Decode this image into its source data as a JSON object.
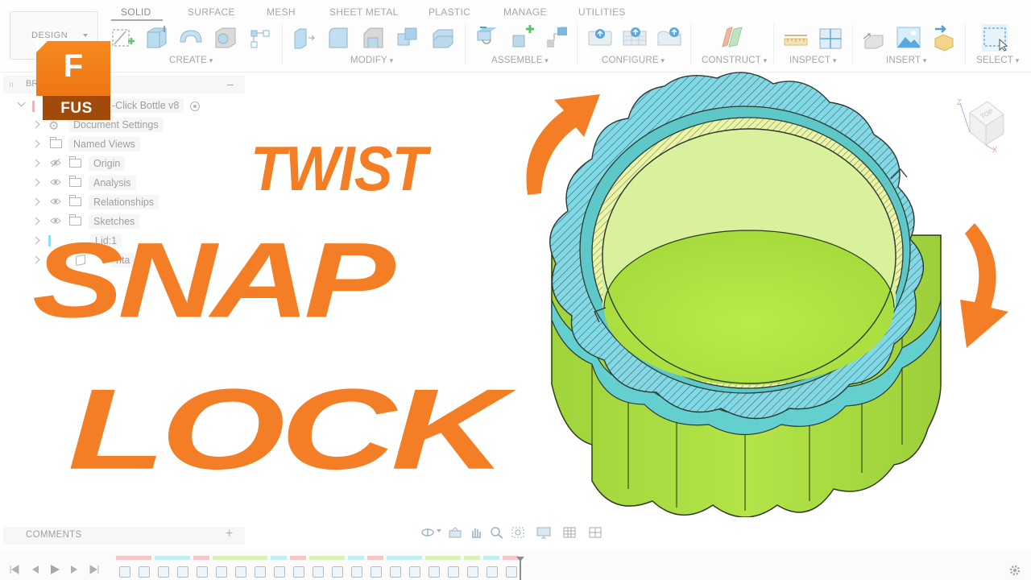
{
  "toolbar": {
    "workspace": "DESIGN",
    "tabs": [
      "SOLID",
      "SURFACE",
      "MESH",
      "SHEET METAL",
      "PLASTIC",
      "MANAGE",
      "UTILITIES"
    ],
    "active_tab": "SOLID",
    "groups": [
      "CREATE",
      "MODIFY",
      "ASSEMBLE",
      "CONFIGURE",
      "CONSTRUCT",
      "INSPECT",
      "INSERT",
      "SELECT"
    ]
  },
  "browser": {
    "title": "BR",
    "root": "-Click Bottle v8",
    "items": [
      "Document Settings",
      "Named Views",
      "Origin",
      "Analysis",
      "Relationships",
      "Sketches",
      "Lid:1",
      "nta"
    ]
  },
  "logo": {
    "letter": "F",
    "text": "FUS",
    "colors": {
      "orange": "#f47e25",
      "dark": "#a04a0c"
    }
  },
  "headline": {
    "line1": "TWIST",
    "line2": "SNAP",
    "line3": "LOCK",
    "color": "#f47e25"
  },
  "viewcube": {
    "face": "TOP",
    "axis_x": "X",
    "axis_z": "Z"
  },
  "comments": {
    "label": "COMMENTS",
    "add": "+"
  },
  "model_colors": {
    "body": "#a9dc41",
    "section": "#7fd8e4",
    "lip": "#e9f4a2",
    "arrow": "#f47e25"
  }
}
